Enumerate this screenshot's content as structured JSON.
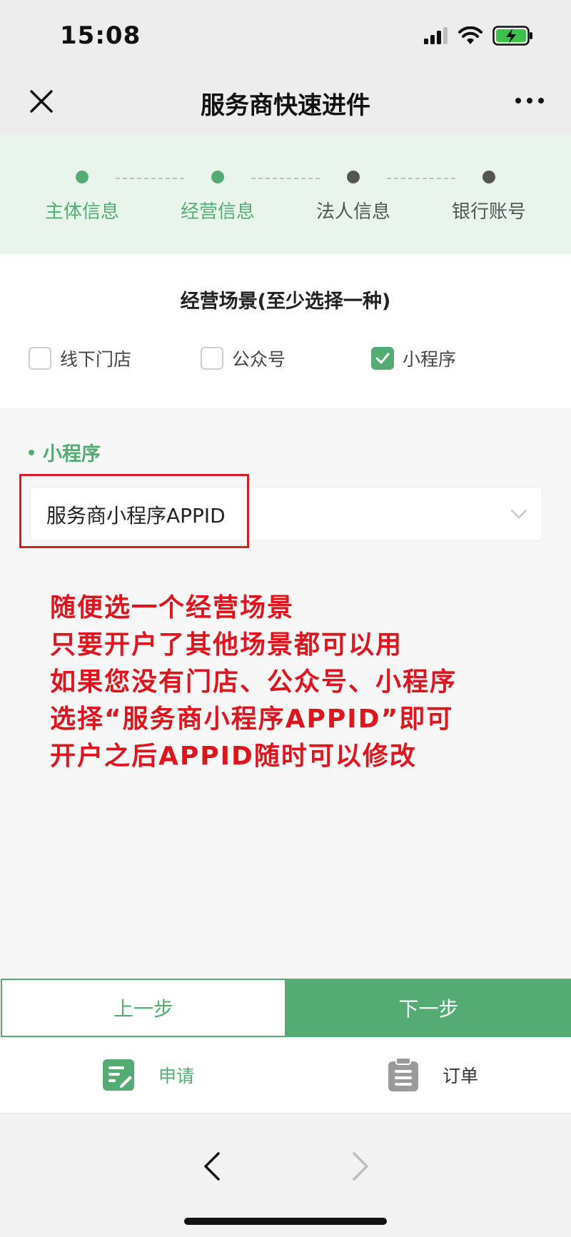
{
  "status_bar": {
    "time": "15:08"
  },
  "nav": {
    "title": "服务商快速进件"
  },
  "stepper": {
    "steps": [
      {
        "label": "主体信息",
        "state": "done"
      },
      {
        "label": "经营信息",
        "state": "active"
      },
      {
        "label": "法人信息",
        "state": "pending"
      },
      {
        "label": "银行账号",
        "state": "pending"
      }
    ],
    "colors": {
      "active": "#54ac74",
      "pending": "#555555"
    }
  },
  "scene": {
    "title": "经营场景(至少选择一种)",
    "options": [
      {
        "label": "线下门店",
        "checked": false
      },
      {
        "label": "公众号",
        "checked": false
      },
      {
        "label": "小程序",
        "checked": true
      }
    ]
  },
  "mini_program": {
    "section_label": "小程序",
    "select_value": "服务商小程序APPID"
  },
  "annotation": {
    "color": "#e0141c",
    "lines": [
      "随便选一个经营场景",
      "只要开户了其他场景都可以用",
      "如果您没有门店、公众号、小程序",
      "选择“服务商小程序APPID”即可",
      "开户之后APPID随时可以修改"
    ]
  },
  "actions": {
    "prev_label": "上一步",
    "next_label": "下一步"
  },
  "tabbar": {
    "items": [
      {
        "label": "申请",
        "icon": "edit-form-icon",
        "active": true
      },
      {
        "label": "订单",
        "icon": "clipboard-icon",
        "active": false
      }
    ]
  },
  "theme": {
    "accent": "#54ac74",
    "header_bg": "#ededed",
    "stepper_bg": "#e9f5ec"
  }
}
